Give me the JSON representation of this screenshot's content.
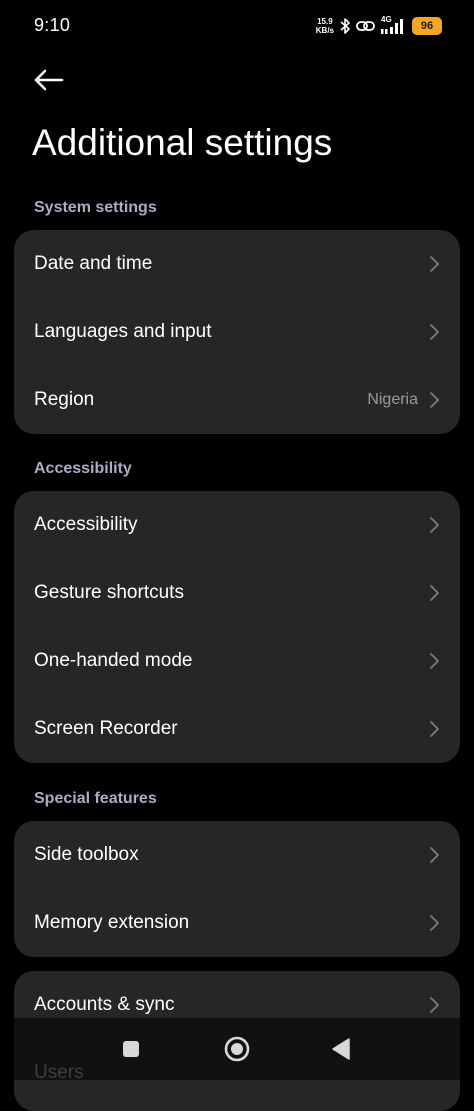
{
  "status_bar": {
    "time": "9:10",
    "net_speed_value": "15.9",
    "net_speed_unit": "KB/s",
    "network_type": "4G",
    "battery_level": "96",
    "battery_color": "#f5a623"
  },
  "header": {
    "back_icon": "arrow-left-icon",
    "title": "Additional settings"
  },
  "sections": [
    {
      "header": "System settings",
      "items": [
        {
          "label": "Date and time",
          "value": ""
        },
        {
          "label": "Languages and input",
          "value": ""
        },
        {
          "label": "Region",
          "value": "Nigeria"
        }
      ]
    },
    {
      "header": "Accessibility",
      "items": [
        {
          "label": "Accessibility",
          "value": ""
        },
        {
          "label": "Gesture shortcuts",
          "value": ""
        },
        {
          "label": "One-handed mode",
          "value": ""
        },
        {
          "label": "Screen Recorder",
          "value": ""
        }
      ]
    },
    {
      "header": "Special features",
      "items": [
        {
          "label": "Side toolbox",
          "value": ""
        },
        {
          "label": "Memory extension",
          "value": ""
        }
      ]
    },
    {
      "header": "",
      "items": [
        {
          "label": "Accounts & sync",
          "value": ""
        },
        {
          "label": "Users",
          "value": ""
        }
      ]
    }
  ],
  "nav_bar": {
    "recents_icon": "square-icon",
    "home_icon": "circle-icon",
    "back_icon": "triangle-back-icon"
  },
  "colors": {
    "background": "#000000",
    "card": "#262626",
    "section_header": "#a9aec6",
    "secondary_text": "#9a9a9a"
  }
}
